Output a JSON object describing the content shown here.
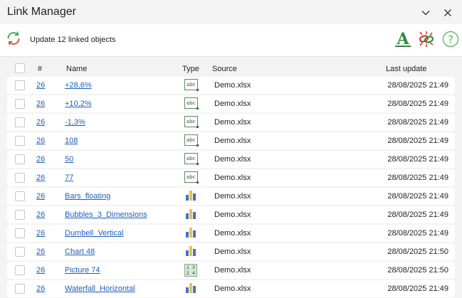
{
  "window": {
    "title": "Link Manager"
  },
  "toolbar": {
    "update_label": "Update 12 linked objects",
    "font_glyph": "A",
    "help_glyph": "?"
  },
  "table": {
    "columns": {
      "num": "#",
      "name": "Name",
      "type": "Type",
      "source": "Source",
      "last_update": "Last update"
    },
    "rows": [
      {
        "num": "26",
        "name": "+28,6%",
        "type": "text",
        "source": "Demo.xlsx",
        "last_update": "28/08/2025 21:49"
      },
      {
        "num": "26",
        "name": "+10,2%",
        "type": "text",
        "source": "Demo.xlsx",
        "last_update": "28/08/2025 21:49"
      },
      {
        "num": "26",
        "name": "-1,3%",
        "type": "text",
        "source": "Demo.xlsx",
        "last_update": "28/08/2025 21:49"
      },
      {
        "num": "26",
        "name": "108",
        "type": "text",
        "source": "Demo.xlsx",
        "last_update": "28/08/2025 21:49"
      },
      {
        "num": "26",
        "name": "50",
        "type": "text",
        "source": "Demo.xlsx",
        "last_update": "28/08/2025 21:49"
      },
      {
        "num": "26",
        "name": "77",
        "type": "text",
        "source": "Demo.xlsx",
        "last_update": "28/08/2025 21:49"
      },
      {
        "num": "26",
        "name": "Bars_floating",
        "type": "chart",
        "source": "Demo.xlsx",
        "last_update": "28/08/2025 21:49"
      },
      {
        "num": "26",
        "name": "Bubbles_3_Dimensions",
        "type": "chart",
        "source": "Demo.xlsx",
        "last_update": "28/08/2025 21:49"
      },
      {
        "num": "26",
        "name": "Dumbell_Vertical",
        "type": "chart",
        "source": "Demo.xlsx",
        "last_update": "28/08/2025 21:49"
      },
      {
        "num": "26",
        "name": "Chart 48",
        "type": "chart",
        "source": "Demo.xlsx",
        "last_update": "28/08/2025 21:50"
      },
      {
        "num": "26",
        "name": "Picture 74",
        "type": "picture",
        "source": "Demo.xlsx",
        "last_update": "28/08/2025 21:50"
      },
      {
        "num": "26",
        "name": "Waterfall_Horizontal",
        "type": "chart",
        "source": "Demo.xlsx",
        "last_update": "28/08/2025 21:49"
      }
    ]
  },
  "icons": {
    "text_type_glyph": "abc",
    "picture_type_glyphs": [
      "1",
      "3",
      "2",
      "4"
    ]
  },
  "colors": {
    "link": "#1f5fbf",
    "font_icon": "#2e8b3d",
    "link_icon_red": "#d23a2a",
    "link_icon_green": "#2e8b3d",
    "help_icon": "#5cb85c",
    "refresh_green": "#3aa64c",
    "refresh_red": "#e0483a"
  }
}
